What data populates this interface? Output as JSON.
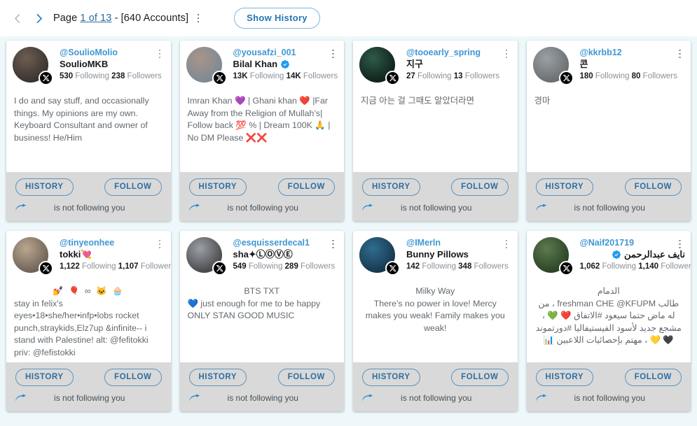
{
  "toolbar": {
    "prev_icon": "chevron-left-icon",
    "next_icon": "chevron-right-icon",
    "page_prefix": "Page ",
    "page_number": "1 of 13",
    "accounts_label": " - [640 Accounts]",
    "show_history_label": "Show History",
    "accent_color": "#2176b5"
  },
  "labels": {
    "history": "HISTORY",
    "follow": "FOLLOW",
    "not_following": "is not following you",
    "following_word": " Following ",
    "followers_word": " Followers"
  },
  "cards": [
    {
      "handle": "@SoulioMolio",
      "display_name": "SoulioMKB",
      "verified": false,
      "following": "530",
      "followers": "238",
      "bio": "I do and say stuff, and occasionally things. My opinions are my own. Keyboard Consultant and owner of business! He/Him",
      "bio_align": "left",
      "avatar_colors": [
        "#3a3330",
        "#6d5e52"
      ],
      "status": "is not following you"
    },
    {
      "handle": "@yousafzi_001",
      "display_name": "Bilal Khan",
      "verified": true,
      "following": "13K",
      "followers": "14K",
      "bio": "Imran Khan 💜 | Ghani khan ❤️ |Far Away from the Religion of Mullah’s| Follow back 💯 % | Dream 100K 🙏 | No DM Please ❌❌",
      "bio_align": "left",
      "avatar_colors": [
        "#7d8a93",
        "#a9948a"
      ],
      "status": "is not following you"
    },
    {
      "handle": "@tooearly_spring",
      "display_name": "지구",
      "verified": false,
      "following": "27",
      "followers": "13",
      "bio": "지금 아는 걸 그때도 알았더라면",
      "bio_align": "left",
      "avatar_colors": [
        "#10231c",
        "#2f5a48"
      ],
      "status": "is not following you"
    },
    {
      "handle": "@kkrbb12",
      "display_name": "콘",
      "verified": false,
      "following": "180",
      "followers": "80",
      "bio": "경마",
      "bio_align": "left",
      "avatar_colors": [
        "#6b6f72",
        "#9aa0a4"
      ],
      "status": "is not following you"
    },
    {
      "handle": "@tinyeonhee",
      "display_name": "tokki💘",
      "verified": false,
      "following": "1,122",
      "followers": "1,107",
      "bio_emoji_row": "💅 🎈 ∞ 🐱 🧁",
      "bio": "stay in felix's eyes•18•she/her•infp•lobs rocket punch,straykids,Elz7up &infinite-- i stand with Palestine! alt: @fefitokki priv: @fefistokki",
      "bio_align": "left",
      "avatar_colors": [
        "#6f6357",
        "#b9a78f"
      ],
      "status": "is not following you"
    },
    {
      "handle": "@esquisserdecal1",
      "display_name": "sha✦ⓁⓄⓋⒺ",
      "verified": false,
      "following": "549",
      "followers": "289",
      "bio_title": "BTS TXT",
      "bio": "💙 just enough for me to be happy ONLY STAN GOOD MUSIC",
      "bio_align": "left",
      "avatar_colors": [
        "#4a4a4c",
        "#9ba0a6"
      ],
      "status": "is not following you"
    },
    {
      "handle": "@IMerln",
      "display_name": "Bunny Pillows",
      "verified": false,
      "following": "142",
      "followers": "348",
      "bio_title": "Milky Way",
      "bio": "There's no power in love! Mercy makes you weak! Family makes you weak!",
      "bio_align": "center",
      "avatar_colors": [
        "#17384f",
        "#2f6d8f"
      ],
      "status": "is not following you"
    },
    {
      "handle": "@Naif201719",
      "display_name": "نايف عبدالرحمن",
      "verified": true,
      "following": "1,062",
      "followers": "1,140",
      "bio_title": "الدمام",
      "bio": "طالب freshman CHE @KFUPM ، من له ماض حتما سيعود #الاتفاق ❤️ 💚 ، مشجع جديد لأسود الفيستيفاليا #دورتموند 🖤 💛 ، مهتم بإحصائيات اللاعبين 📊",
      "bio_align": "rtl",
      "avatar_colors": [
        "#2c4427",
        "#5c7a4e"
      ],
      "status": "is not following you"
    }
  ]
}
